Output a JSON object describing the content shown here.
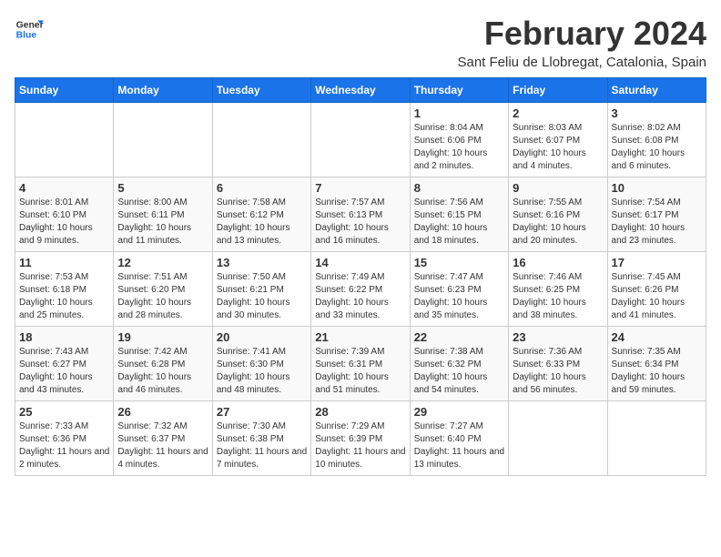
{
  "header": {
    "logo_line1": "General",
    "logo_line2": "Blue",
    "title": "February 2024",
    "subtitle": "Sant Feliu de Llobregat, Catalonia, Spain"
  },
  "weekdays": [
    "Sunday",
    "Monday",
    "Tuesday",
    "Wednesday",
    "Thursday",
    "Friday",
    "Saturday"
  ],
  "weeks": [
    [
      {
        "day": "",
        "info": ""
      },
      {
        "day": "",
        "info": ""
      },
      {
        "day": "",
        "info": ""
      },
      {
        "day": "",
        "info": ""
      },
      {
        "day": "1",
        "info": "Sunrise: 8:04 AM\nSunset: 6:06 PM\nDaylight: 10 hours and 2 minutes."
      },
      {
        "day": "2",
        "info": "Sunrise: 8:03 AM\nSunset: 6:07 PM\nDaylight: 10 hours and 4 minutes."
      },
      {
        "day": "3",
        "info": "Sunrise: 8:02 AM\nSunset: 6:08 PM\nDaylight: 10 hours and 6 minutes."
      }
    ],
    [
      {
        "day": "4",
        "info": "Sunrise: 8:01 AM\nSunset: 6:10 PM\nDaylight: 10 hours and 9 minutes."
      },
      {
        "day": "5",
        "info": "Sunrise: 8:00 AM\nSunset: 6:11 PM\nDaylight: 10 hours and 11 minutes."
      },
      {
        "day": "6",
        "info": "Sunrise: 7:58 AM\nSunset: 6:12 PM\nDaylight: 10 hours and 13 minutes."
      },
      {
        "day": "7",
        "info": "Sunrise: 7:57 AM\nSunset: 6:13 PM\nDaylight: 10 hours and 16 minutes."
      },
      {
        "day": "8",
        "info": "Sunrise: 7:56 AM\nSunset: 6:15 PM\nDaylight: 10 hours and 18 minutes."
      },
      {
        "day": "9",
        "info": "Sunrise: 7:55 AM\nSunset: 6:16 PM\nDaylight: 10 hours and 20 minutes."
      },
      {
        "day": "10",
        "info": "Sunrise: 7:54 AM\nSunset: 6:17 PM\nDaylight: 10 hours and 23 minutes."
      }
    ],
    [
      {
        "day": "11",
        "info": "Sunrise: 7:53 AM\nSunset: 6:18 PM\nDaylight: 10 hours and 25 minutes."
      },
      {
        "day": "12",
        "info": "Sunrise: 7:51 AM\nSunset: 6:20 PM\nDaylight: 10 hours and 28 minutes."
      },
      {
        "day": "13",
        "info": "Sunrise: 7:50 AM\nSunset: 6:21 PM\nDaylight: 10 hours and 30 minutes."
      },
      {
        "day": "14",
        "info": "Sunrise: 7:49 AM\nSunset: 6:22 PM\nDaylight: 10 hours and 33 minutes."
      },
      {
        "day": "15",
        "info": "Sunrise: 7:47 AM\nSunset: 6:23 PM\nDaylight: 10 hours and 35 minutes."
      },
      {
        "day": "16",
        "info": "Sunrise: 7:46 AM\nSunset: 6:25 PM\nDaylight: 10 hours and 38 minutes."
      },
      {
        "day": "17",
        "info": "Sunrise: 7:45 AM\nSunset: 6:26 PM\nDaylight: 10 hours and 41 minutes."
      }
    ],
    [
      {
        "day": "18",
        "info": "Sunrise: 7:43 AM\nSunset: 6:27 PM\nDaylight: 10 hours and 43 minutes."
      },
      {
        "day": "19",
        "info": "Sunrise: 7:42 AM\nSunset: 6:28 PM\nDaylight: 10 hours and 46 minutes."
      },
      {
        "day": "20",
        "info": "Sunrise: 7:41 AM\nSunset: 6:30 PM\nDaylight: 10 hours and 48 minutes."
      },
      {
        "day": "21",
        "info": "Sunrise: 7:39 AM\nSunset: 6:31 PM\nDaylight: 10 hours and 51 minutes."
      },
      {
        "day": "22",
        "info": "Sunrise: 7:38 AM\nSunset: 6:32 PM\nDaylight: 10 hours and 54 minutes."
      },
      {
        "day": "23",
        "info": "Sunrise: 7:36 AM\nSunset: 6:33 PM\nDaylight: 10 hours and 56 minutes."
      },
      {
        "day": "24",
        "info": "Sunrise: 7:35 AM\nSunset: 6:34 PM\nDaylight: 10 hours and 59 minutes."
      }
    ],
    [
      {
        "day": "25",
        "info": "Sunrise: 7:33 AM\nSunset: 6:36 PM\nDaylight: 11 hours and 2 minutes."
      },
      {
        "day": "26",
        "info": "Sunrise: 7:32 AM\nSunset: 6:37 PM\nDaylight: 11 hours and 4 minutes."
      },
      {
        "day": "27",
        "info": "Sunrise: 7:30 AM\nSunset: 6:38 PM\nDaylight: 11 hours and 7 minutes."
      },
      {
        "day": "28",
        "info": "Sunrise: 7:29 AM\nSunset: 6:39 PM\nDaylight: 11 hours and 10 minutes."
      },
      {
        "day": "29",
        "info": "Sunrise: 7:27 AM\nSunset: 6:40 PM\nDaylight: 11 hours and 13 minutes."
      },
      {
        "day": "",
        "info": ""
      },
      {
        "day": "",
        "info": ""
      }
    ]
  ]
}
